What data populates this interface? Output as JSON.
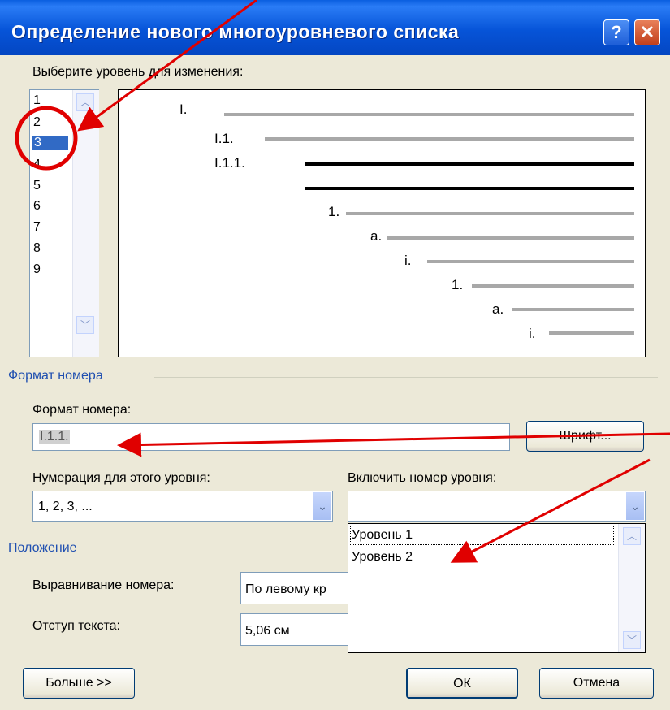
{
  "window": {
    "title": "Определение нового многоуровневого списка",
    "help": "?",
    "close": "✕"
  },
  "levels": {
    "label": "Выберите уровень для изменения:",
    "items": [
      "1",
      "2",
      "3",
      "4",
      "5",
      "6",
      "7",
      "8",
      "9"
    ],
    "selected": "3"
  },
  "preview": {
    "numbers": [
      "I.",
      "I.1.",
      "I.1.1.",
      "1.",
      "a.",
      "i.",
      "1.",
      "a.",
      "i."
    ]
  },
  "number_format": {
    "group_title": "Формат номера",
    "format_label": "Формат номера:",
    "format_value": "I.1.1.",
    "font_button": "Шрифт...",
    "numbering_label": "Нумерация для этого уровня:",
    "numbering_value": "1, 2, 3, ...",
    "include_label": "Включить номер уровня:",
    "include_value": "",
    "include_options": [
      "Уровень 1",
      "Уровень 2"
    ]
  },
  "position": {
    "group_title": "Положение",
    "align_label": "Выравнивание номера:",
    "align_value": "По левому кр",
    "indent_label": "Отступ текста:",
    "indent_value": "5,06 см"
  },
  "buttons": {
    "more": "Больше >>",
    "ok": "ОК",
    "cancel": "Отмена"
  },
  "colors": {
    "annotation": "#e00000",
    "selection": "#316ac5",
    "titlebar": "#0654d8"
  }
}
